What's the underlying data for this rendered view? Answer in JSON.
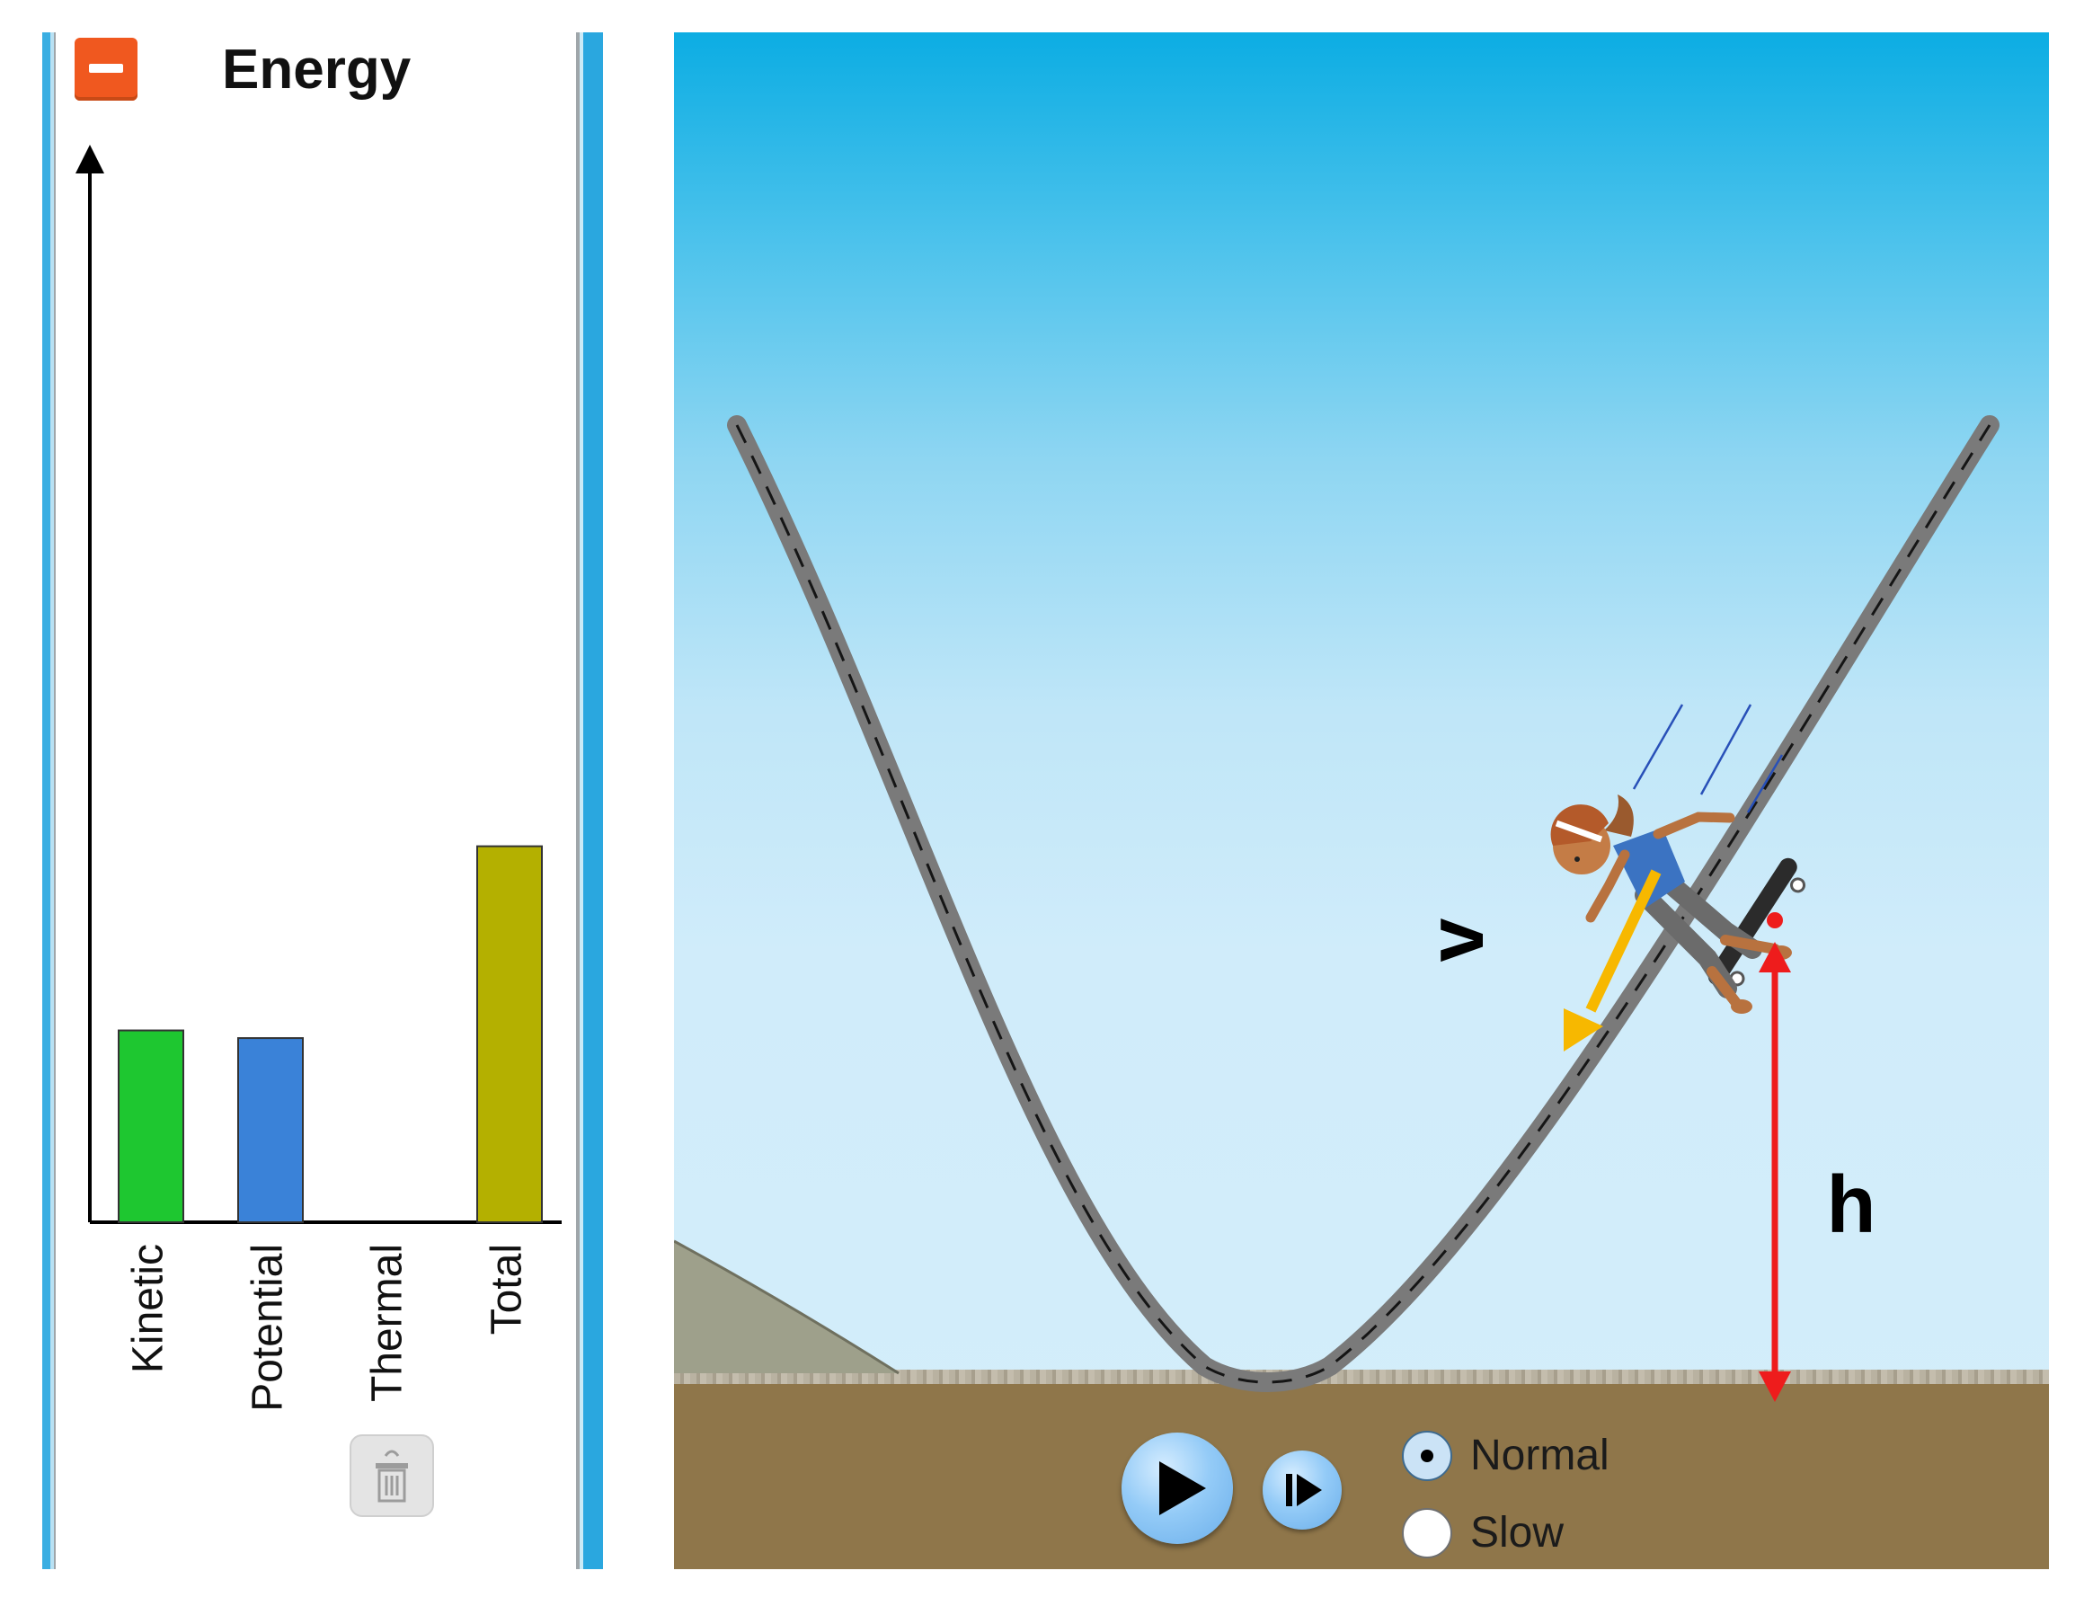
{
  "energy_panel": {
    "title": "Energy",
    "collapse_icon": "minus-icon",
    "trash_icon": "trash-icon"
  },
  "chart_data": {
    "type": "bar",
    "categories": [
      "Kinetic",
      "Potential",
      "Thermal",
      "Total"
    ],
    "values": [
      1.0,
      0.96,
      0,
      1.96
    ],
    "title": "",
    "xlabel": "",
    "ylabel": "",
    "ylim": [
      0,
      5.5
    ],
    "colors": [
      "#1ec730",
      "#3a82d8",
      "#e02020",
      "#b4b000"
    ],
    "grid": false
  },
  "scene": {
    "vectors": {
      "velocity_label": "v",
      "height_label": "h"
    },
    "colors": {
      "velocity": "#f7b800",
      "height": "#ee1c1c",
      "track": "#7a7a7a",
      "ground": "#8f764a"
    },
    "playback": {
      "play_icon": "play-icon",
      "step_icon": "step-forward-icon",
      "speed_options": [
        {
          "label": "Normal",
          "selected": true
        },
        {
          "label": "Slow",
          "selected": false
        }
      ]
    }
  }
}
